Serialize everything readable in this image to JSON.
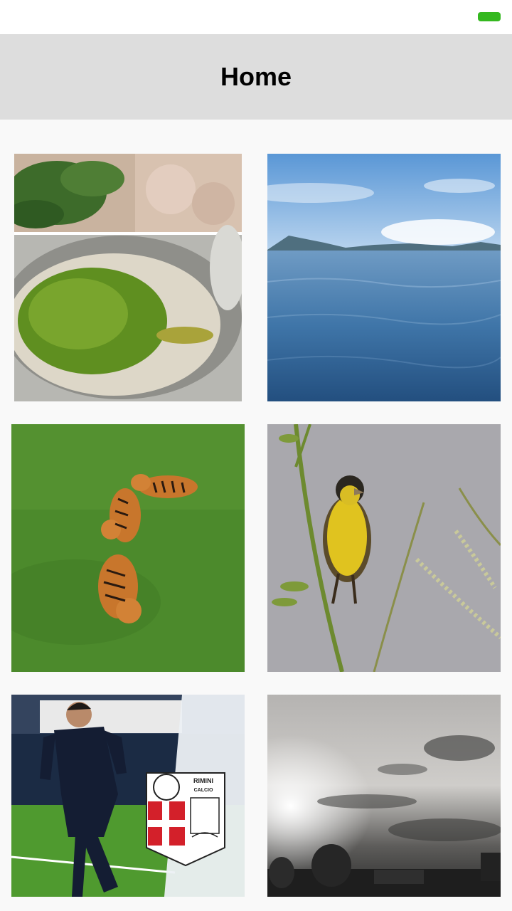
{
  "status_bar": {
    "battery_icon": "battery-icon",
    "battery_color": "#34b81f"
  },
  "app_bar": {
    "title": "Home",
    "background": "#dddddd"
  },
  "gallery": {
    "tiles": [
      {
        "subject": "pesto-cooking-photo"
      },
      {
        "subject": "lake-sea-photo"
      },
      {
        "subject": "tigers-on-grass-photo"
      },
      {
        "subject": "yellow-bird-on-stem-photo"
      },
      {
        "subject": "football-player-photo",
        "logo_text": [
          "RIMINI",
          "CALCIO"
        ]
      },
      {
        "subject": "cloudy-sky-bw-photo"
      }
    ]
  }
}
